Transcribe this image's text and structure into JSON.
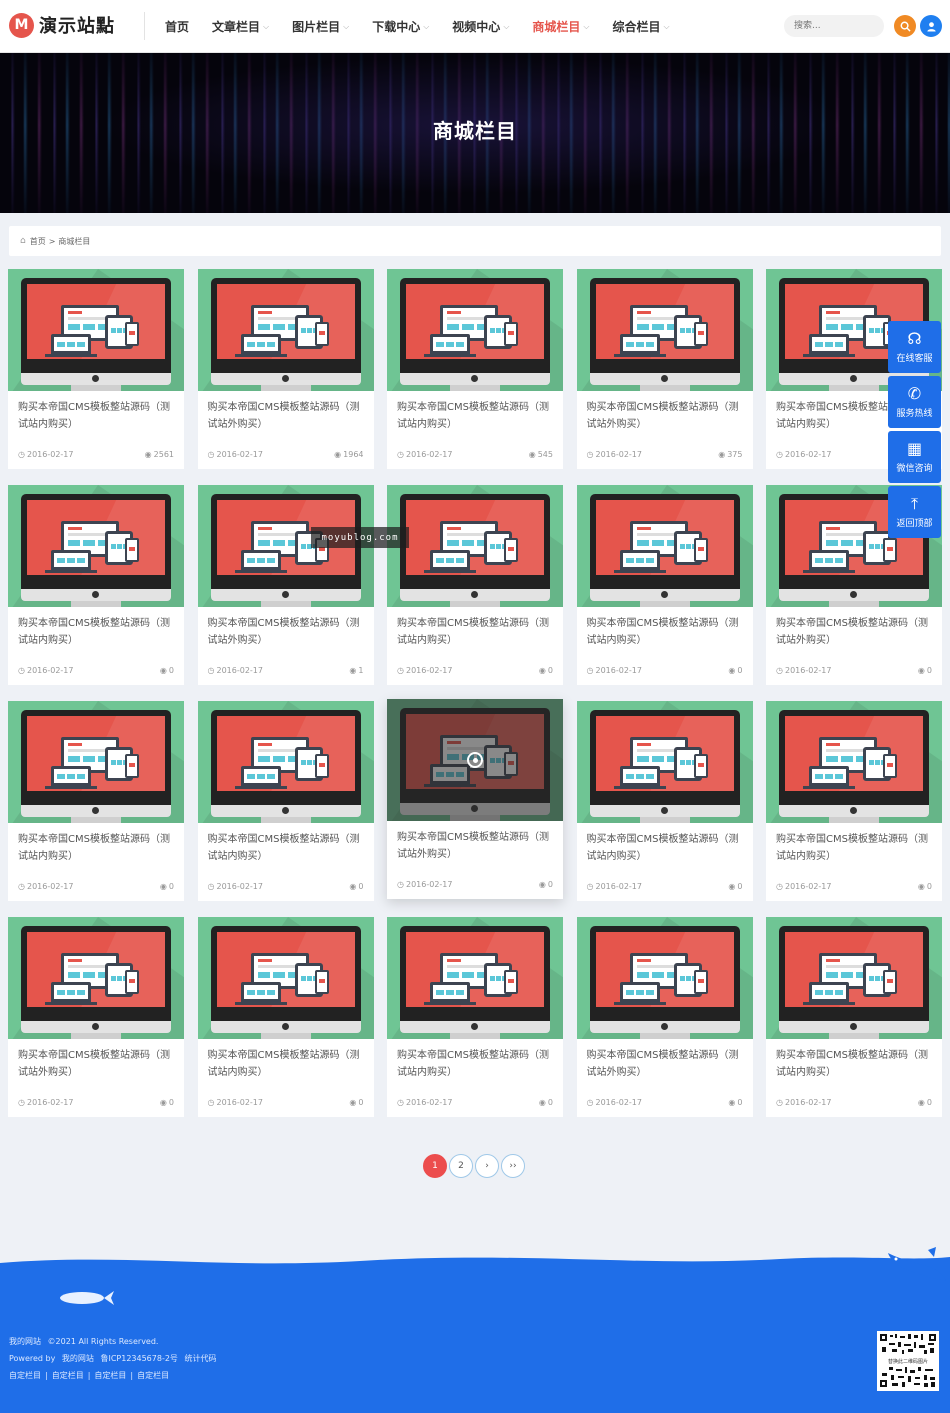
{
  "header": {
    "logo_mark": "M",
    "logo_text": "演示站點",
    "nav": [
      {
        "label": "首页",
        "has_caret": false,
        "active": false
      },
      {
        "label": "文章栏目",
        "has_caret": true,
        "active": false
      },
      {
        "label": "图片栏目",
        "has_caret": true,
        "active": false
      },
      {
        "label": "下载中心",
        "has_caret": true,
        "active": false
      },
      {
        "label": "视频中心",
        "has_caret": true,
        "active": false
      },
      {
        "label": "商城栏目",
        "has_caret": true,
        "active": true
      },
      {
        "label": "综合栏目",
        "has_caret": true,
        "active": false
      }
    ],
    "search_placeholder": "搜索..."
  },
  "banner": {
    "title": "商城栏目"
  },
  "breadcrumb": {
    "home": "首页",
    "separator": ">",
    "current": "商城栏目"
  },
  "products": [
    {
      "title": "购买本帝国CMS模板整站源码（测试站内购买）",
      "date": "2016-02-17",
      "views": "2561"
    },
    {
      "title": "购买本帝国CMS模板整站源码（测试站外购买）",
      "date": "2016-02-17",
      "views": "1964"
    },
    {
      "title": "购买本帝国CMS模板整站源码（测试站内购买）",
      "date": "2016-02-17",
      "views": "545"
    },
    {
      "title": "购买本帝国CMS模板整站源码（测试站外购买）",
      "date": "2016-02-17",
      "views": "375"
    },
    {
      "title": "购买本帝国CMS模板整站源码（测试站内购买）",
      "date": "2016-02-17",
      "views": ""
    },
    {
      "title": "购买本帝国CMS模板整站源码（测试站内购买）",
      "date": "2016-02-17",
      "views": "0"
    },
    {
      "title": "购买本帝国CMS模板整站源码（测试站外购买）",
      "date": "2016-02-17",
      "views": "1"
    },
    {
      "title": "购买本帝国CMS模板整站源码（测试站内购买）",
      "date": "2016-02-17",
      "views": "0"
    },
    {
      "title": "购买本帝国CMS模板整站源码（测试站内购买）",
      "date": "2016-02-17",
      "views": "0"
    },
    {
      "title": "购买本帝国CMS模板整站源码（测试站外购买）",
      "date": "2016-02-17",
      "views": "0"
    },
    {
      "title": "购买本帝国CMS模板整站源码（测试站内购买）",
      "date": "2016-02-17",
      "views": "0"
    },
    {
      "title": "购买本帝国CMS模板整站源码（测试站内购买）",
      "date": "2016-02-17",
      "views": "0"
    },
    {
      "title": "购买本帝国CMS模板整站源码（测试站外购买）",
      "date": "2016-02-17",
      "views": "0",
      "hover": true
    },
    {
      "title": "购买本帝国CMS模板整站源码（测试站内购买）",
      "date": "2016-02-17",
      "views": "0"
    },
    {
      "title": "购买本帝国CMS模板整站源码（测试站内购买）",
      "date": "2016-02-17",
      "views": "0"
    },
    {
      "title": "购买本帝国CMS模板整站源码（测试站外购买）",
      "date": "2016-02-17",
      "views": "0"
    },
    {
      "title": "购买本帝国CMS模板整站源码（测试站内购买）",
      "date": "2016-02-17",
      "views": "0"
    },
    {
      "title": "购买本帝国CMS模板整站源码（测试站内购买）",
      "date": "2016-02-17",
      "views": "0"
    },
    {
      "title": "购买本帝国CMS模板整站源码（测试站外购买）",
      "date": "2016-02-17",
      "views": "0"
    },
    {
      "title": "购买本帝国CMS模板整站源码（测试站内购买）",
      "date": "2016-02-17",
      "views": "0"
    }
  ],
  "watermark": "moyublog.com",
  "side_bar": [
    {
      "icon": "headset-icon",
      "glyph": "☊",
      "label": "在线客服"
    },
    {
      "icon": "phone-icon",
      "glyph": "✆",
      "label": "服务热线"
    },
    {
      "icon": "qrcode-icon",
      "glyph": "▦",
      "label": "微信咨询"
    },
    {
      "icon": "back-to-top-icon",
      "glyph": "⤒",
      "label": "返回顶部"
    }
  ],
  "pagination": {
    "pages": [
      "1",
      "2"
    ],
    "current": "1",
    "next": "›",
    "last": "››"
  },
  "footer": {
    "site_name": "我的网站",
    "copyright": "©2021 All Rights Reserved.",
    "powered_prefix": "Powered by",
    "powered_site": "我的网站",
    "icp": "鲁ICP12345678-2号",
    "stats": "统计代码",
    "links": [
      "自定栏目",
      "自定栏目",
      "自定栏目",
      "自定栏目"
    ],
    "qr_caption": "替换此二维码图片"
  },
  "colors": {
    "accent": "#e5554c",
    "footer_blue": "#1f6ee8",
    "card_thumb_bg": "#6fc594",
    "side_bar": "#1f6ee8"
  }
}
